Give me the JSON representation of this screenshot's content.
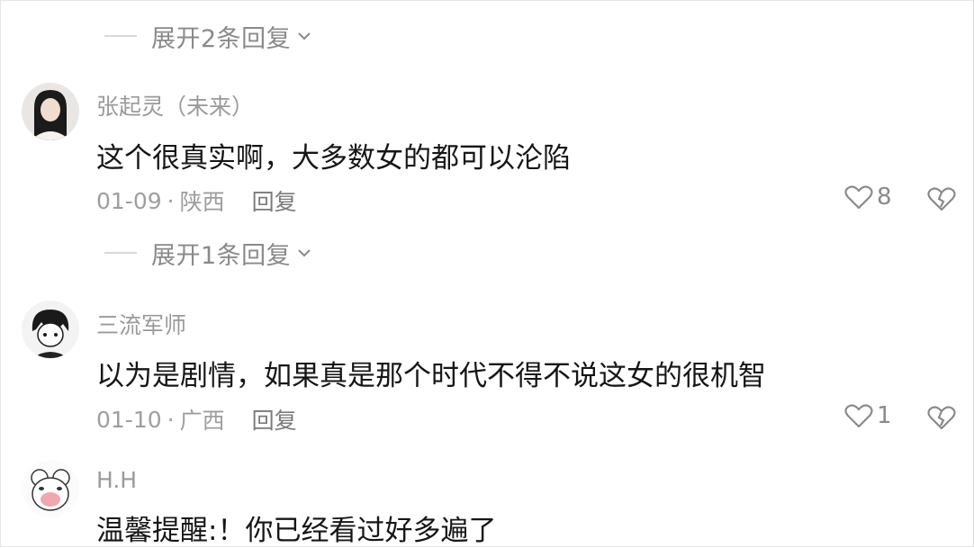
{
  "expand_top": {
    "label": "展开2条回复"
  },
  "comments": [
    {
      "username": "张起灵（未来）",
      "text": "这个很真实啊，大多数女的都可以沦陷",
      "date": "01-09",
      "location": "陕西",
      "reply_label": "回复",
      "likes": "8",
      "expand_label": "展开1条回复"
    },
    {
      "username": "三流军师",
      "text": "以为是剧情，如果真是那个时代不得不说这女的很机智",
      "date": "01-10",
      "location": "广西",
      "reply_label": "回复",
      "likes": "1"
    },
    {
      "username": "H.H",
      "text": "温馨提醒:！你已经看过好多遍了"
    }
  ],
  "meta_separator": "·",
  "icons": {
    "expand": "chevron-down-icon",
    "like": "heart-outline-icon",
    "dislike": "broken-heart-icon"
  },
  "colors": {
    "text": "#161616",
    "secondary": "#9a9a9a",
    "background": "#ffffff"
  }
}
